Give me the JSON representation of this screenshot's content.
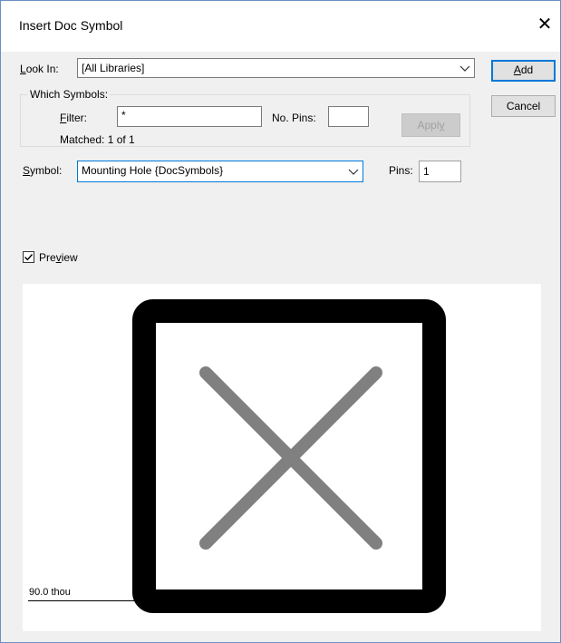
{
  "window": {
    "title": "Insert Doc Symbol",
    "close_glyph": "✕"
  },
  "look_in": {
    "label_prefix": "L",
    "label_rest": "ook In:",
    "value": "[All Libraries]"
  },
  "buttons": {
    "add_prefix": "A",
    "add_rest": "dd",
    "cancel": "Cancel",
    "apply_prefix": "Appl",
    "apply_u": "y"
  },
  "which_symbols": {
    "title": "Which Symbols:",
    "filter_label_prefix": "F",
    "filter_label_rest": "ilter:",
    "filter_value": "*",
    "no_pins_label": "No. Pins:",
    "no_pins_value": "",
    "matched": "Matched: 1 of 1"
  },
  "symbol": {
    "label_prefix": "S",
    "label_rest": "ymbol:",
    "value": "Mounting Hole {DocSymbols}"
  },
  "pins": {
    "label": "Pins:",
    "value": "1"
  },
  "preview": {
    "checked": true,
    "label_prefix": "Pre",
    "label_u": "v",
    "label_rest": "iew",
    "scale": "90.0 thou"
  },
  "colors": {
    "accent": "#0078d7",
    "symbol_outline": "#000000",
    "symbol_cross": "#808080"
  }
}
